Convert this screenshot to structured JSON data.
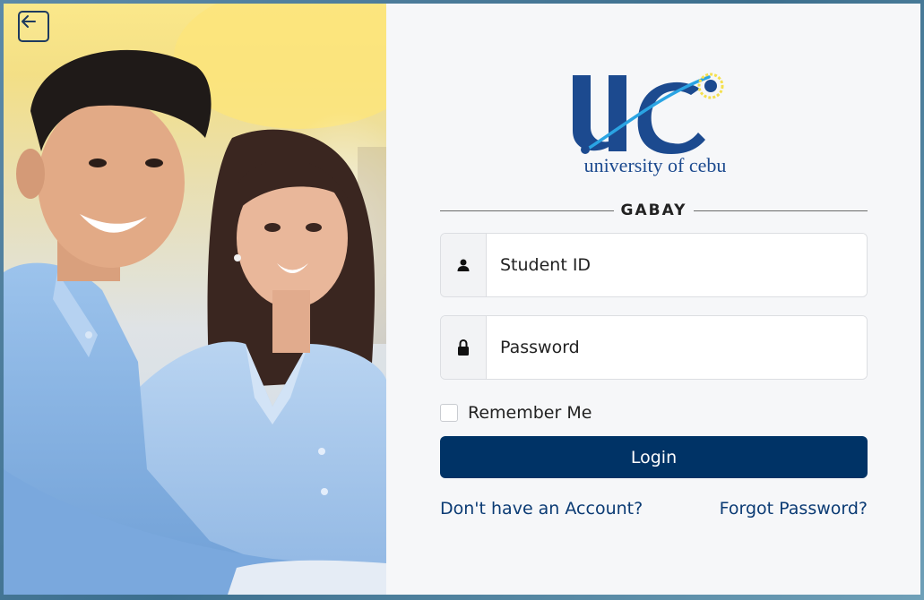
{
  "header": {
    "back_icon": "arrow-left-icon"
  },
  "logo": {
    "monogram": "uc",
    "wordmark": "university of cebu",
    "brand_color": "#1c4a8f",
    "accent_color": "#f4e04d"
  },
  "form": {
    "section_title": "GABAY",
    "student_id": {
      "icon": "user-icon",
      "placeholder": "Student ID",
      "value": ""
    },
    "password": {
      "icon": "lock-icon",
      "placeholder": "Password",
      "value": ""
    },
    "remember_label": "Remember Me",
    "remember_checked": false,
    "login_label": "Login",
    "register_link": "Don't have an Account?",
    "forgot_link": "Forgot Password?",
    "primary_color": "#003366"
  }
}
